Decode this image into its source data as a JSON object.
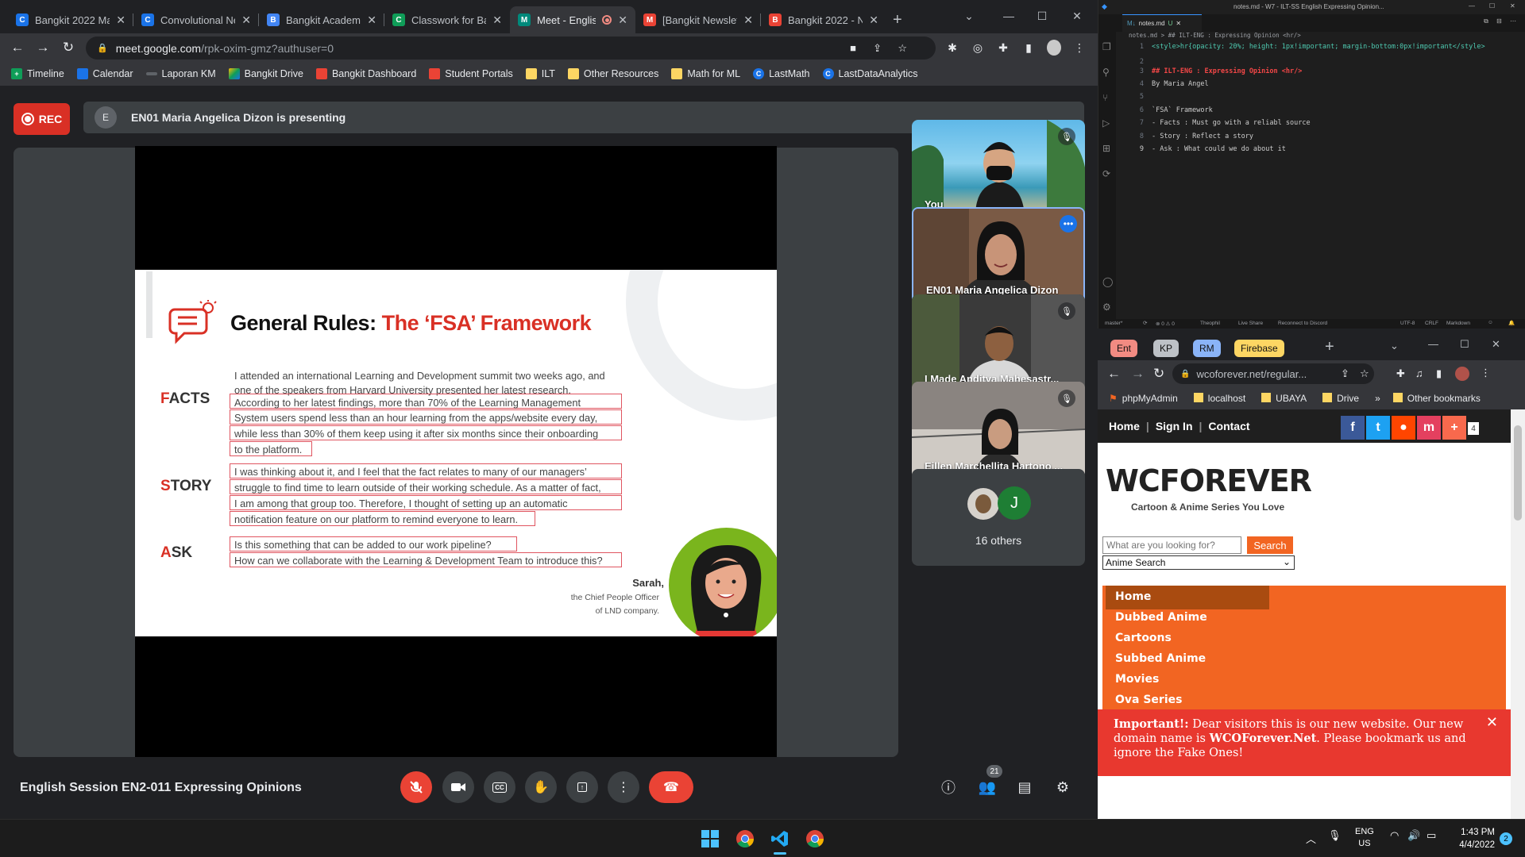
{
  "left_browser": {
    "tabs": [
      {
        "title": "Bangkit 2022 Ma",
        "icon": "C",
        "color": "#1a73e8"
      },
      {
        "title": "Convolutional Ne",
        "icon": "C",
        "color": "#1a73e8"
      },
      {
        "title": "Bangkit Academy",
        "icon": "B",
        "color": "#4285f4"
      },
      {
        "title": "Classwork for Ba",
        "icon": "C",
        "color": "#0f9d58"
      },
      {
        "title": "Meet - Englis",
        "icon": "M",
        "color": "#00897b"
      },
      {
        "title": "[Bangkit Newslett",
        "icon": "M",
        "color": "#ea4335"
      },
      {
        "title": "Bangkit 2022 - N",
        "icon": "B",
        "color": "#ea4335"
      }
    ],
    "url_main": "meet.google.com",
    "url_rest": "/rpk-oxim-gmz?authuser=0",
    "bookmarks": [
      {
        "label": "Timeline",
        "color": "#0f9d58"
      },
      {
        "label": "Calendar",
        "color": "#1a73e8"
      },
      {
        "label": "Laporan KM",
        "color": "#5f6368"
      },
      {
        "label": "Bangkit Drive",
        "color": "#fbbc04"
      },
      {
        "label": "Bangkit Dashboard",
        "color": "#ea4335"
      },
      {
        "label": "Student Portals",
        "color": "#ea4335"
      },
      {
        "label": "ILT",
        "color": "#fdd663"
      },
      {
        "label": "Other Resources",
        "color": "#fdd663"
      },
      {
        "label": "Math for ML",
        "color": "#fdd663"
      },
      {
        "label": "LastMath",
        "color": "#1a73e8"
      },
      {
        "label": "LastDataAnalytics",
        "color": "#1a73e8"
      }
    ]
  },
  "meet": {
    "rec_label": "REC",
    "presenter_initial": "E",
    "presenting_text": "EN01 Maria Angelica Dizon is presenting",
    "meeting_name": "English Session EN2-011 Expressing Opinions",
    "participants_count": "21",
    "participants": [
      {
        "name": "You"
      },
      {
        "name": "EN01 Maria Angelica Dizon"
      },
      {
        "name": "I Made Anditya Mahesastr..."
      },
      {
        "name": "Eillen Marchellita Hartono ..."
      }
    ],
    "others_initial": "J",
    "others_label": "16 others"
  },
  "slide": {
    "title_black": "General Rules: ",
    "title_red": "The ‘FSA’ Framework",
    "facts_first": "F",
    "facts_rest": "ACTS",
    "story_first": "S",
    "story_rest": "TORY",
    "ask_first": "A",
    "ask_rest": "SK",
    "lines": [
      "I attended an international Learning and Development summit two weeks ago, and",
      "one of the speakers from Harvard University presented her latest research.",
      "According to her latest findings, more than 70% of the Learning Management",
      "System users spend less than an hour learning from the apps/website every day,",
      "while less than 30% of them keep using it after six months since their onboarding",
      "to the platform.",
      "I was thinking about it, and I feel that the fact relates to many of our managers’",
      "struggle to find time to learn outside of their working schedule. As a matter of fact,",
      "I am among that group too. Therefore, I thought of setting up an automatic",
      "notification feature on our platform to remind everyone to learn.",
      "Is this something that can be added to our work pipeline?",
      "How can we collaborate with the Learning & Development Team to introduce this?"
    ],
    "sarah": "Sarah,",
    "sarah_role1": "the Chief People Officer",
    "sarah_role2": "of LND company."
  },
  "vscode": {
    "title": "notes.md - W7 - ILT-SS English Expressing Opinion...",
    "tab": "notes.md",
    "tab_badge": "U",
    "breadcrumb": "notes.md > ## ILT-ENG : Expressing Opinion <hr/>",
    "code": [
      {
        "n": "1",
        "text": "<style>hr{opacity: 20%; height: 1px!important; margin-bottom:0px!important</style>"
      },
      {
        "n": "2",
        "text": ""
      },
      {
        "n": "3",
        "text": "## ILT-ENG : Expressing Opinion <hr/>"
      },
      {
        "n": "4",
        "text": "By Maria Angel"
      },
      {
        "n": "5",
        "text": ""
      },
      {
        "n": "6",
        "text": "`FSA` Framework"
      },
      {
        "n": "7",
        "text": "- Facts : Must go with a reliabl source"
      },
      {
        "n": "8",
        "text": "- Story : Reflect a story"
      },
      {
        "n": "9",
        "text": "- Ask : What could we do about it"
      }
    ],
    "status": {
      "branch": "master*",
      "problems": "⊗ 0 ⚠ 0",
      "user": "Theophil",
      "liveshare": "Live Share",
      "discord": "Reconnect to Discord",
      "encoding": "UTF-8",
      "eol": "CRLF",
      "lang": "Markdown"
    }
  },
  "right_browser": {
    "tabs": [
      {
        "label": "Ent",
        "color": "#f28b82"
      },
      {
        "label": "KP",
        "color": "#bdc1c6"
      },
      {
        "label": "RM",
        "color": "#8ab4f8"
      },
      {
        "label": "Firebase",
        "color": "#fdd663"
      }
    ],
    "url": "wcoforever.net/regular...",
    "bookmarks": [
      "phpMyAdmin",
      "localhost",
      "UBAYA",
      "Drive"
    ],
    "other_bookmarks": "Other bookmarks",
    "site": {
      "nav": [
        "Home",
        "Sign In",
        "Contact"
      ],
      "share_count": "4",
      "logo": "WCFOREVER",
      "tagline": "Cartoon & Anime Series You Love",
      "search_placeholder": "What are you looking for?",
      "search_button": "Search",
      "select_value": "Anime Search",
      "menu": [
        "Home",
        "Dubbed Anime",
        "Cartoons",
        "Subbed Anime",
        "Movies",
        "Ova Series"
      ],
      "notice_bold": "Important!:",
      "notice_text": " Dear visitors this is our new website. Our new domain name is ",
      "notice_domain": "WCOForever.Net",
      "notice_tail": ". Please bookmark us and ignore the Fake Ones!"
    }
  },
  "taskbar": {
    "lang1": "ENG",
    "lang2": "US",
    "time": "1:43 PM",
    "date": "4/4/2022",
    "notif": "2"
  }
}
